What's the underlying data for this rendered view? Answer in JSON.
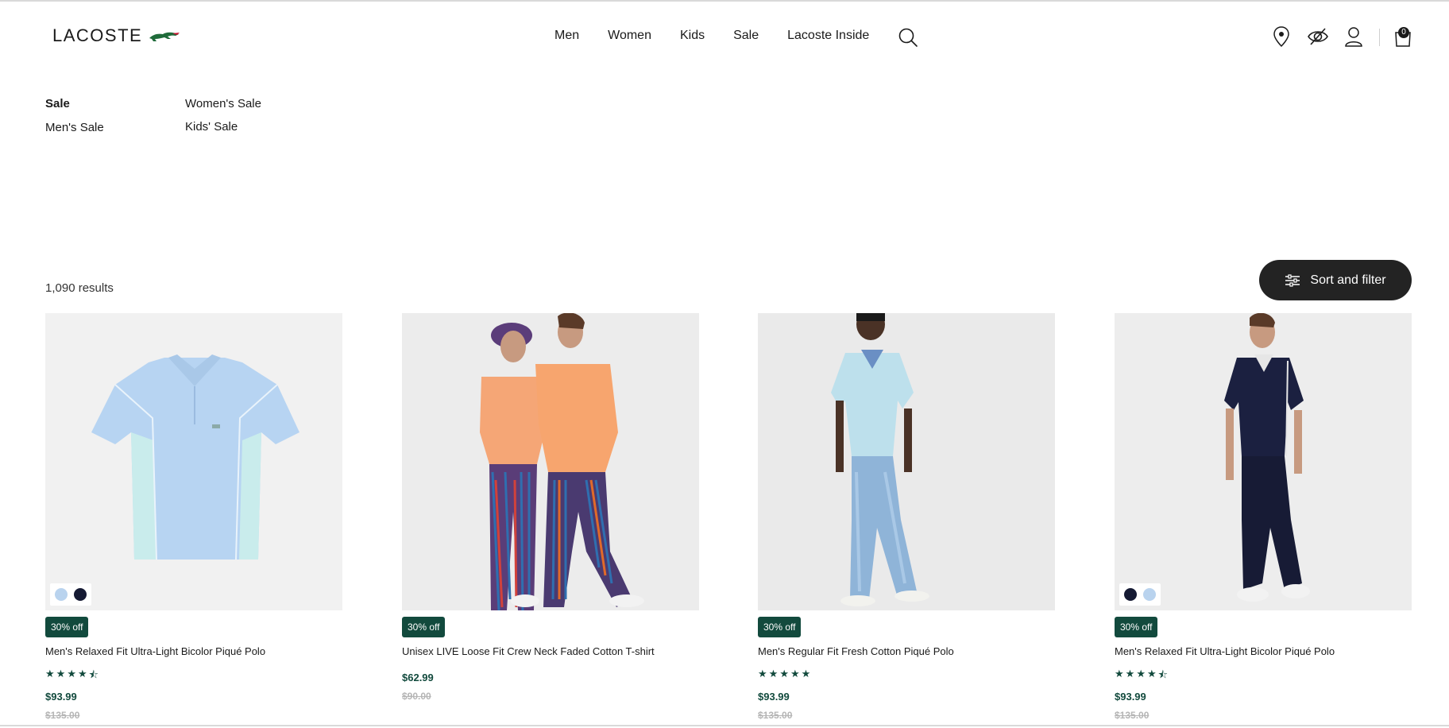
{
  "header": {
    "logo_text": "LACOSTE",
    "nav": [
      "Men",
      "Women",
      "Kids",
      "Sale",
      "Lacoste Inside"
    ],
    "cart_count": "0"
  },
  "subnav": {
    "items": [
      {
        "label": "Sale",
        "active": true
      },
      {
        "label": "Women's Sale",
        "active": false
      },
      {
        "label": "Men's Sale",
        "active": false
      },
      {
        "label": "Kids' Sale",
        "active": false
      }
    ]
  },
  "results": {
    "count_text": "1,090 results",
    "sort_label": "Sort and filter"
  },
  "products": [
    {
      "badge": "30% off",
      "name": "Men's Relaxed Fit Ultra-Light Bicolor Piqué Polo",
      "rating": 4.5,
      "price": "$93.99",
      "old_price": "$135.00",
      "swatches": [
        "#b9d3ee",
        "#151a33"
      ]
    },
    {
      "badge": "30% off",
      "name": "Unisex LIVE Loose Fit Crew Neck Faded Cotton T-shirt",
      "rating": null,
      "price": "$62.99",
      "old_price": "$90.00",
      "swatches": []
    },
    {
      "badge": "30% off",
      "name": "Men's Regular Fit Fresh Cotton Piqué Polo",
      "rating": 5,
      "price": "$93.99",
      "old_price": "$135.00",
      "swatches": []
    },
    {
      "badge": "30% off",
      "name": "Men's Relaxed Fit Ultra-Light Bicolor Piqué Polo",
      "rating": 4.5,
      "price": "$93.99",
      "old_price": "$135.00",
      "swatches": [
        "#151a33",
        "#b9d3ee"
      ]
    }
  ],
  "colors": {
    "brand_green": "#124a3d",
    "button_dark": "#232323"
  }
}
